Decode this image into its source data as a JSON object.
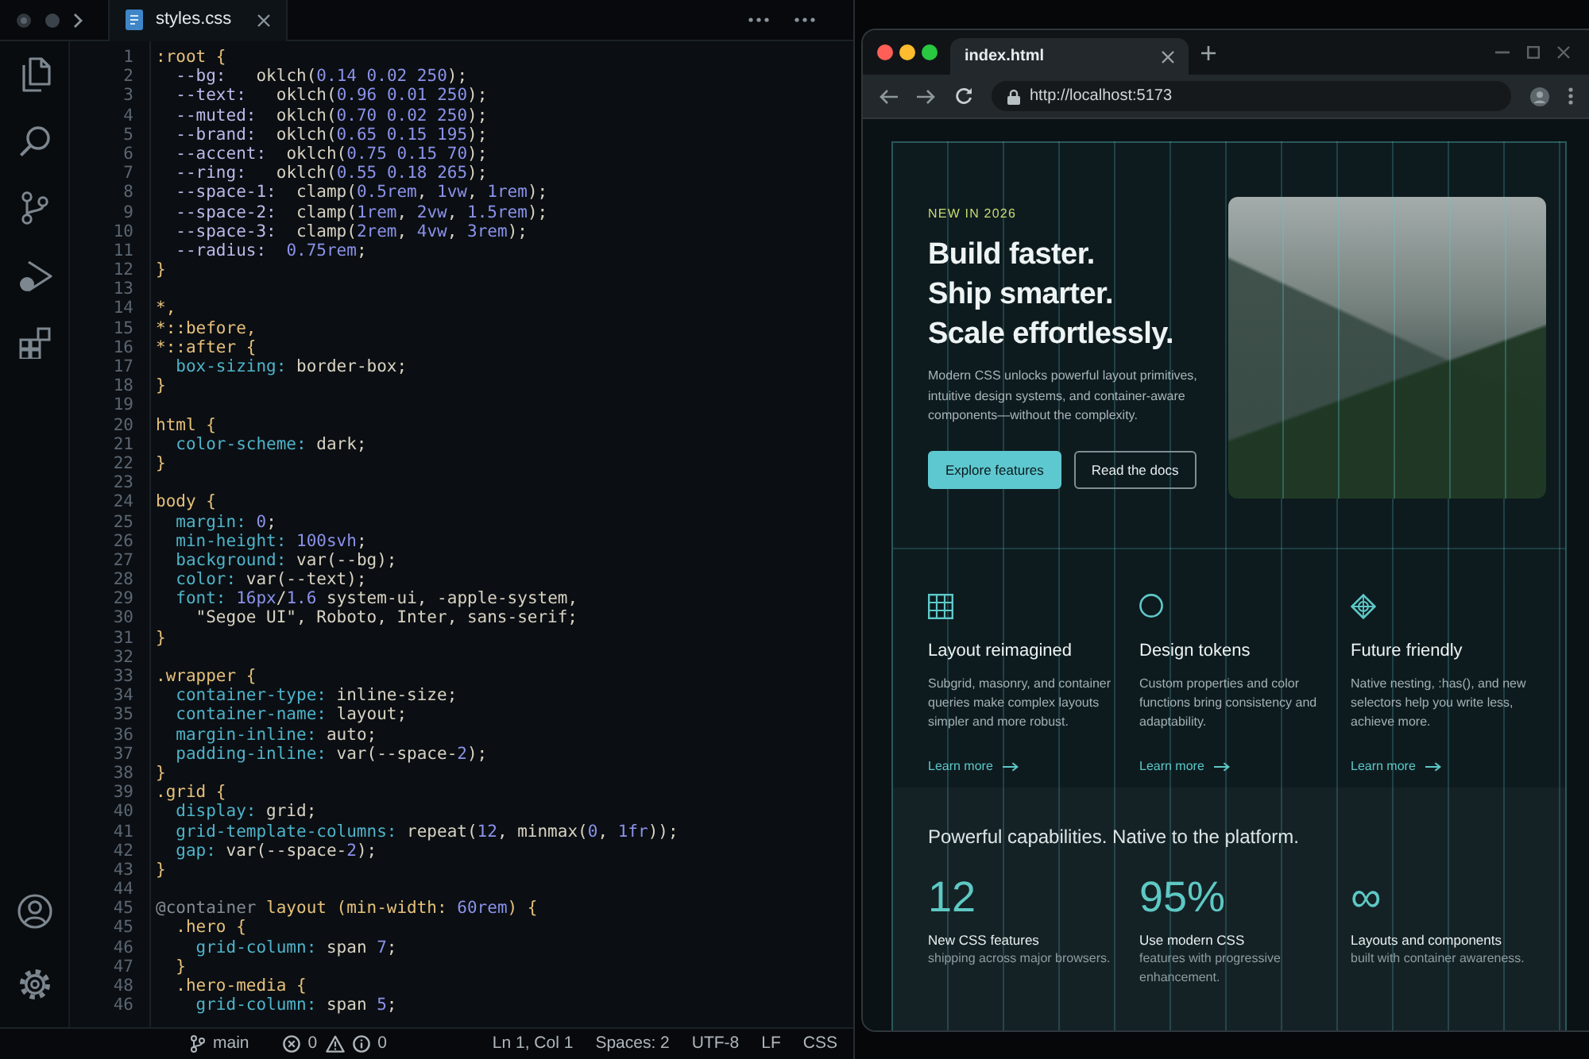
{
  "editor": {
    "tab": {
      "label": "styles.css"
    },
    "lines": [
      {
        "n": "1",
        "kind": "selector",
        "text": ":root {"
      },
      {
        "n": "2",
        "kind": "custom-property",
        "text": "  --bg:   oklch(0.14 0.02 250);"
      },
      {
        "n": "3",
        "kind": "custom-property",
        "text": "  --text:   oklch(0.96 0.01 250);"
      },
      {
        "n": "4",
        "kind": "custom-property",
        "text": "  --muted:  oklch(0.70 0.02 250);"
      },
      {
        "n": "5",
        "kind": "custom-property",
        "text": "  --brand:  oklch(0.65 0.15 195);"
      },
      {
        "n": "6",
        "kind": "custom-property",
        "text": "  --accent:  oklch(0.75 0.15 70);"
      },
      {
        "n": "7",
        "kind": "custom-property",
        "text": "  --ring:   oklch(0.55 0.18 265);"
      },
      {
        "n": "8",
        "kind": "custom-property",
        "text": "  --space-1:  clamp(0.5rem, 1vw, 1rem);"
      },
      {
        "n": "9",
        "kind": "custom-property",
        "text": "  --space-2:  clamp(1rem, 2vw, 1.5rem);"
      },
      {
        "n": "10",
        "kind": "custom-property",
        "text": "  --space-3:  clamp(2rem, 4vw, 3rem);"
      },
      {
        "n": "11",
        "kind": "custom-property",
        "text": "  --radius:  0.75rem;"
      },
      {
        "n": "12",
        "kind": "brace",
        "text": "}"
      },
      {
        "n": "13"
      },
      {
        "n": "14",
        "kind": "selector",
        "text": "*,"
      },
      {
        "n": "15",
        "kind": "selector",
        "text": "*::before,"
      },
      {
        "n": "16",
        "kind": "selector",
        "text": "*::after {"
      },
      {
        "n": "17",
        "kind": "declaration",
        "text": "  box-sizing: border-box;"
      },
      {
        "n": "18",
        "kind": "brace",
        "text": "}"
      },
      {
        "n": "19"
      },
      {
        "n": "20",
        "kind": "selector",
        "text": "html {"
      },
      {
        "n": "21",
        "kind": "declaration",
        "text": "  color-scheme: dark;"
      },
      {
        "n": "22",
        "kind": "brace",
        "text": "}"
      },
      {
        "n": "23"
      },
      {
        "n": "24",
        "kind": "selector",
        "text": "body {"
      },
      {
        "n": "25",
        "kind": "declaration",
        "text": "  margin: 0;"
      },
      {
        "n": "26",
        "kind": "declaration",
        "text": "  min-height: 100svh;"
      },
      {
        "n": "27",
        "kind": "declaration",
        "text": "  background: var(--bg);"
      },
      {
        "n": "28",
        "kind": "declaration",
        "text": "  color: var(--text);"
      },
      {
        "n": "29",
        "kind": "declaration",
        "text": "  font: 16px/1.6 system-ui, -apple-system,"
      },
      {
        "n": "30",
        "kind": "continuation",
        "text": "    \"Segoe UI\", Roboto, Inter, sans-serif;"
      },
      {
        "n": "31",
        "kind": "brace",
        "text": "}"
      },
      {
        "n": "32"
      },
      {
        "n": "33",
        "kind": "selector",
        "text": ".wrapper {"
      },
      {
        "n": "34",
        "kind": "declaration",
        "text": "  container-type: inline-size;"
      },
      {
        "n": "35",
        "kind": "declaration",
        "text": "  container-name: layout;"
      },
      {
        "n": "36",
        "kind": "declaration",
        "text": "  margin-inline: auto;"
      },
      {
        "n": "37",
        "kind": "declaration",
        "text": "  padding-inline: var(--space-2);"
      },
      {
        "n": "38",
        "kind": "brace",
        "text": "}"
      },
      {
        "n": "39",
        "kind": "selector",
        "text": ".grid {"
      },
      {
        "n": "40",
        "kind": "declaration",
        "text": "  display: grid;"
      },
      {
        "n": "41",
        "kind": "declaration",
        "text": "  grid-template-columns: repeat(12, minmax(0, 1fr));"
      },
      {
        "n": "42",
        "kind": "declaration",
        "text": "  gap: var(--space-2);"
      },
      {
        "n": "43",
        "kind": "brace",
        "text": "}"
      },
      {
        "n": "44"
      },
      {
        "n": "45",
        "kind": "at-rule",
        "text": "@container layout (min-width: 60rem) {"
      },
      {
        "n": "45",
        "kind": "selector",
        "text": "  .hero {"
      },
      {
        "n": "46",
        "kind": "declaration",
        "text": "    grid-column: span 7;"
      },
      {
        "n": "47",
        "kind": "brace",
        "text": "  }"
      },
      {
        "n": "48",
        "kind": "selector",
        "text": "  .hero-media {"
      },
      {
        "n": "46",
        "kind": "declaration",
        "text": "    grid-column: span 5;"
      }
    ],
    "status_bar": {
      "branch": "main",
      "error_count": "0",
      "info_count": "0",
      "items": [
        "Ln 1, Col 1",
        "Spaces: 2",
        "UTF-8",
        "LF",
        "CSS"
      ]
    }
  },
  "browser": {
    "tab": {
      "title": "index.html"
    },
    "address": "http://localhost:5173",
    "hero": {
      "eyebrow": "NEW IN 2026",
      "heading_lines": [
        "Build faster.",
        "Ship smarter.",
        "Scale effortlessly."
      ],
      "description": "Modern CSS unlocks powerful layout primitives, intuitive design systems, and container-aware components—without the complexity.",
      "buttons": [
        {
          "label": "Explore features",
          "kind": "primary"
        },
        {
          "label": "Read the docs",
          "kind": "outline"
        }
      ]
    },
    "features": [
      {
        "title": "Layout reimagined",
        "description": "Subgrid, masonry, and container queries make complex layouts simpler and more robust.",
        "link": "Learn more"
      },
      {
        "title": "Design tokens",
        "description": "Custom properties and color functions bring consistency and adaptability.",
        "link": "Learn more"
      },
      {
        "title": "Future friendly",
        "description": "Native nesting, :has(), and new selectors help you write less, achieve more.",
        "link": "Learn more"
      }
    ],
    "stats": {
      "heading": "Powerful capabilities. Native to the platform.",
      "items": [
        {
          "value": "12",
          "label": "New CSS features",
          "description": "shipping across major browsers."
        },
        {
          "value": "95%",
          "label": "Use modern CSS",
          "description": "features with progressive enhancement."
        },
        {
          "value": "∞",
          "label": "Layouts and components",
          "description": "built with container awareness."
        }
      ]
    }
  }
}
